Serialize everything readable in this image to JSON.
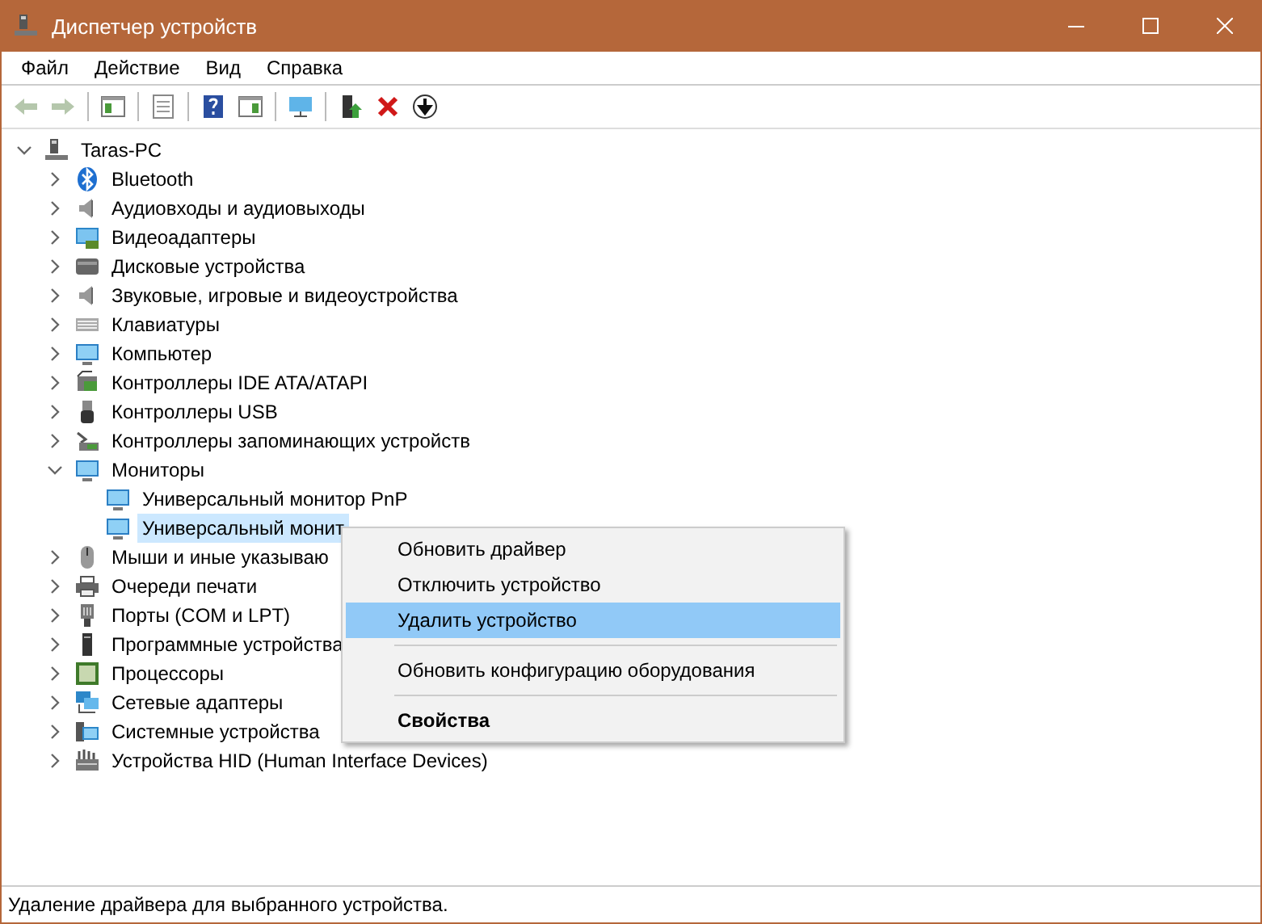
{
  "window": {
    "title": "Диспетчер устройств"
  },
  "menu": [
    "Файл",
    "Действие",
    "Вид",
    "Справка"
  ],
  "toolbar": [
    {
      "disabled": true
    },
    {
      "disabled": true
    },
    {
      "disabled": false
    },
    {
      "disabled": false
    },
    {
      "disabled": false
    },
    {
      "disabled": false
    },
    {
      "disabled": false
    },
    {
      "disabled": false
    },
    {
      "disabled": false
    },
    {
      "disabled": false
    }
  ],
  "tree": {
    "label": "Taras-PC",
    "expanded": true,
    "selected": false,
    "children": [
      {
        "label": "Bluetooth",
        "expanded": false,
        "selected": false
      },
      {
        "label": "Аудиовходы и аудиовыходы",
        "expanded": false,
        "selected": false
      },
      {
        "label": "Видеоадаптеры",
        "expanded": false,
        "selected": false
      },
      {
        "label": "Дисковые устройства",
        "expanded": false,
        "selected": false
      },
      {
        "label": "Звуковые, игровые и видеоустройства",
        "expanded": false,
        "selected": false
      },
      {
        "label": "Клавиатуры",
        "expanded": false,
        "selected": false
      },
      {
        "label": "Компьютер",
        "expanded": false,
        "selected": false
      },
      {
        "label": "Контроллеры IDE ATA/ATAPI",
        "expanded": false,
        "selected": false
      },
      {
        "label": "Контроллеры USB",
        "expanded": false,
        "selected": false
      },
      {
        "label": "Контроллеры запоминающих устройств",
        "expanded": false,
        "selected": false
      },
      {
        "label": "Мониторы",
        "expanded": true,
        "selected": false,
        "children": [
          {
            "label": "Универсальный монитор PnP",
            "selected": false
          },
          {
            "label": "Универсальный монит",
            "selected": true
          }
        ]
      },
      {
        "label": "Мыши и иные указываю",
        "expanded": false,
        "selected": false
      },
      {
        "label": "Очереди печати",
        "expanded": false,
        "selected": false
      },
      {
        "label": "Порты (COM и LPT)",
        "expanded": false,
        "selected": false
      },
      {
        "label": "Программные устройства",
        "expanded": false,
        "selected": false
      },
      {
        "label": "Процессоры",
        "expanded": false,
        "selected": false
      },
      {
        "label": "Сетевые адаптеры",
        "expanded": false,
        "selected": false
      },
      {
        "label": "Системные устройства",
        "expanded": false,
        "selected": false
      },
      {
        "label": "Устройства HID (Human Interface Devices)",
        "expanded": false,
        "selected": false
      }
    ]
  },
  "context_menu": {
    "items": [
      {
        "kind": "item",
        "label": "Обновить драйвер",
        "selected": false,
        "default": false
      },
      {
        "kind": "item",
        "label": "Отключить устройство",
        "selected": false,
        "default": false
      },
      {
        "kind": "item",
        "label": "Удалить устройство",
        "selected": true,
        "default": false
      },
      {
        "kind": "separator"
      },
      {
        "kind": "item",
        "label": "Обновить конфигурацию оборудования",
        "selected": false,
        "default": false
      },
      {
        "kind": "separator"
      },
      {
        "kind": "item",
        "label": "Свойства",
        "selected": false,
        "default": true
      }
    ]
  },
  "status_bar": "Удаление драйвера для выбранного устройства."
}
